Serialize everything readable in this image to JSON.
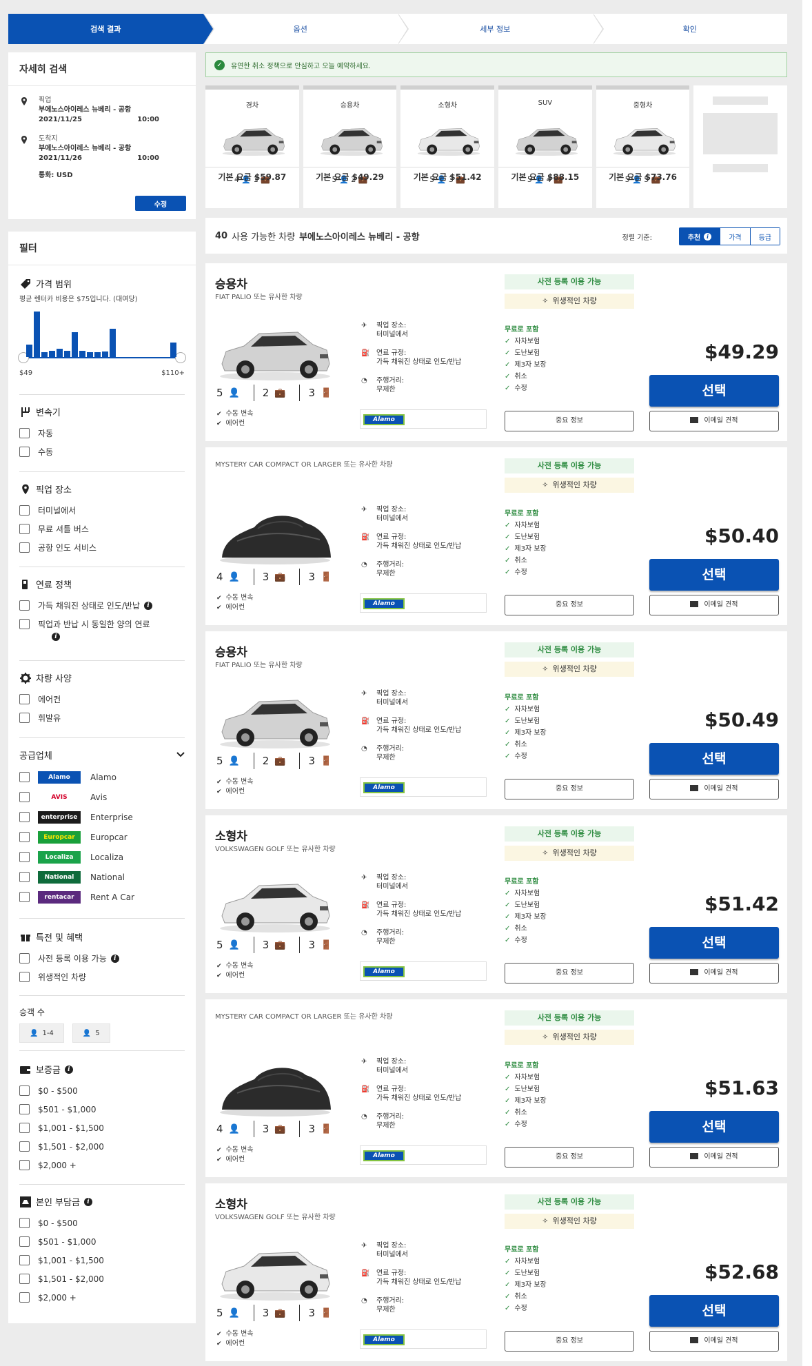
{
  "steps": [
    "검색 결과",
    "옵션",
    "세부 정보",
    "확인"
  ],
  "search": {
    "title": "자세히 검색",
    "pickup_label": "픽업",
    "pickup_location": "부에노스아이레스 뉴베리 - 공항",
    "pickup_date": "2021/11/25",
    "pickup_time": "10:00",
    "dropoff_label": "도착지",
    "dropoff_location": "부에노스아이레스 뉴베리 - 공항",
    "dropoff_date": "2021/11/26",
    "dropoff_time": "10:00",
    "currency": "통화: USD",
    "edit_label": "수정"
  },
  "filters": {
    "title": "필터",
    "price_range": {
      "title": "가격 범위",
      "avg_text": "평균 렌터카 비용은 $75입니다. (대여당)",
      "min_label": "$49",
      "max_label": "$110+",
      "histogram": [
        0.28,
        1.0,
        0.1,
        0.14,
        0.18,
        0.14,
        0.55,
        0.14,
        0.1,
        0.1,
        0.12,
        0.62,
        0,
        0,
        0,
        0,
        0,
        0,
        0,
        0.32
      ]
    },
    "transmission": {
      "title": "변속기",
      "options": [
        "자동",
        "수동"
      ]
    },
    "pickup_location": {
      "title": "픽업 장소",
      "options": [
        "터미널에서",
        "무료 셔틀 버스",
        "공항 인도 서비스"
      ]
    },
    "fuel_policy": {
      "title": "연료 정책",
      "options": [
        "가득 채워진 상태로 인도/반납",
        "픽업과 반납 시 동일한 양의 연료"
      ]
    },
    "car_specs": {
      "title": "차량 사양",
      "options": [
        "에어컨",
        "휘발유"
      ]
    },
    "suppliers": {
      "title": "공급업체",
      "items": [
        {
          "name": "Alamo",
          "logo": "Alamo",
          "bg": "#0a52b3",
          "fg": "#ffffff"
        },
        {
          "name": "Avis",
          "logo": "AVIS",
          "bg": "#ffffff",
          "fg": "#d4002a"
        },
        {
          "name": "Enterprise",
          "logo": "enterprise",
          "bg": "#1b1b1b",
          "fg": "#ffffff"
        },
        {
          "name": "Europcar",
          "logo": "Europcar",
          "bg": "#19a03a",
          "fg": "#ffe600"
        },
        {
          "name": "Localiza",
          "logo": "Localiza",
          "bg": "#1aa34a",
          "fg": "#ffffff"
        },
        {
          "name": "National",
          "logo": "National",
          "bg": "#0f6b3b",
          "fg": "#ffffff"
        },
        {
          "name": "Rent A Car",
          "logo": "rentacar",
          "bg": "#5b2a7e",
          "fg": "#ffffff"
        }
      ]
    },
    "deals": {
      "title": "특전 및 혜택",
      "options": [
        "사전 등록 이용 가능",
        "위생적인 차량"
      ]
    },
    "passengers": {
      "title": "승객 수",
      "options": [
        "1-4",
        "5"
      ]
    },
    "deposit": {
      "title": "보증금",
      "options": [
        "$0 - $500",
        "$501 - $1,000",
        "$1,001 - $1,500",
        "$1,501 - $2,000",
        "$2,000 +"
      ]
    },
    "excess": {
      "title": "본인 부담금",
      "options": [
        "$0 - $500",
        "$501 - $1,000",
        "$1,001 - $1,500",
        "$1,501 - $2,000",
        "$2,000 +"
      ]
    }
  },
  "notice": "유연한 취소 정책으로 안심하고 오늘 예약하세요.",
  "categories": [
    {
      "name": "경차",
      "seats": "4",
      "bags": "1",
      "price": "기본 요금 $59.87"
    },
    {
      "name": "승용차",
      "seats": "5",
      "bags": "2",
      "price": "기본 요금 $49.29"
    },
    {
      "name": "소형차",
      "seats": "5",
      "bags": "3",
      "price": "기본 요금 $51.42"
    },
    {
      "name": "SUV",
      "seats": "5",
      "bags": "4",
      "price": "기본 요금 $88.15"
    },
    {
      "name": "중형차",
      "seats": "5",
      "bags": "5",
      "price": "기본 요금 $73.76"
    }
  ],
  "results": {
    "count": "40",
    "text": "사용 가능한 차량",
    "location": "부에노스아이레스 뉴베리 - 공항",
    "sort_label": "정렬 기준:",
    "sort_options": [
      "추천",
      "가격",
      "등급"
    ]
  },
  "labels": {
    "badge_prereg": "사전 등록 이용 가능",
    "badge_sanitized": "위생적인 차량",
    "included_title": "무료로 포함",
    "included": [
      "자차보험",
      "도난보험",
      "제3자 보장",
      "취소",
      "수정"
    ],
    "pickup_place_label": "픽업 장소:",
    "pickup_place_value": "터미널에서",
    "fuel_label": "연료 규정:",
    "fuel_value": "가득 채워진 상태로 인도/반납",
    "mileage_label": "주행거리:",
    "mileage_value": "무제한",
    "feature_transmission": "수동 변속",
    "feature_ac": "에어컨",
    "supplier_logo": "Alamo",
    "important_info": "중요 정보",
    "select": "선택",
    "email_quote": "이메일 견적"
  },
  "listings": [
    {
      "category": "승용차",
      "model": "FIAT PALIO 또는 유사한 차량",
      "seats": "5",
      "bags": "2",
      "doors": "3",
      "price": "$49.29",
      "car": "hatch"
    },
    {
      "category": "",
      "model": "MYSTERY CAR COMPACT OR LARGER 또는 유사한 차량",
      "seats": "4",
      "bags": "3",
      "doors": "3",
      "price": "$50.40",
      "car": "mystery"
    },
    {
      "category": "승용차",
      "model": "FIAT PALIO 또는 유사한 차량",
      "seats": "5",
      "bags": "2",
      "doors": "3",
      "price": "$50.49",
      "car": "hatch"
    },
    {
      "category": "소형차",
      "model": "VOLKSWAGEN GOLF 또는 유사한 차량",
      "seats": "5",
      "bags": "3",
      "doors": "3",
      "price": "$51.42",
      "car": "golf"
    },
    {
      "category": "",
      "model": "MYSTERY CAR COMPACT OR LARGER 또는 유사한 차량",
      "seats": "4",
      "bags": "3",
      "doors": "3",
      "price": "$51.63",
      "car": "mystery"
    },
    {
      "category": "소형차",
      "model": "VOLKSWAGEN GOLF 또는 유사한 차량",
      "seats": "5",
      "bags": "3",
      "doors": "3",
      "price": "$52.68",
      "car": "golf"
    }
  ]
}
